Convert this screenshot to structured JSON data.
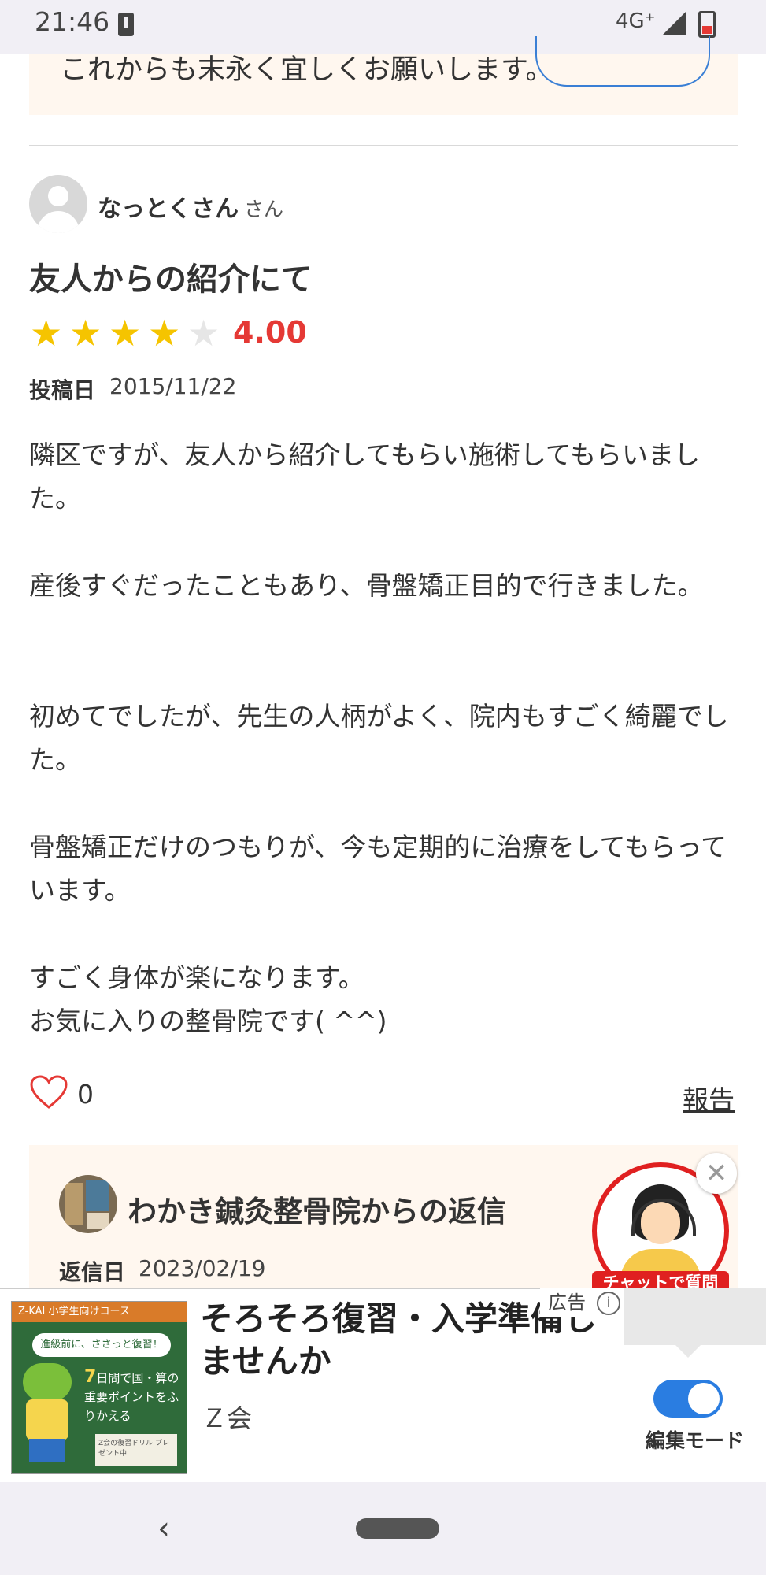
{
  "status_bar": {
    "time": "21:46",
    "network": "4G⁺"
  },
  "previous_reply": {
    "text_tail": "これからも末永く宜しくお願いします。",
    "button_label": ""
  },
  "review": {
    "reviewer_name": "なっとくさん",
    "reviewer_suffix": "さん",
    "title": "友人からの紹介にて",
    "stars": {
      "filled": 4,
      "total": 5
    },
    "rating": "4.00",
    "post_label": "投稿日",
    "post_date": "2015/11/22",
    "paragraphs": [
      "隣区ですが、友人から紹介してもらい施術してもらいました。",
      "産後すぐだったこともあり、骨盤矯正目的で行きました。",
      "初めてでしたが、先生の人柄がよく、院内もすごく綺麗でした。",
      "骨盤矯正だけのつもりが、今も定期的に治療をしてもらっています。",
      "すごく身体が楽になります。",
      "お気に入りの整骨院です( ^^)"
    ],
    "like_count": "0",
    "report_label": "報告"
  },
  "reply": {
    "title": "わかき鍼灸整骨院からの返信",
    "date_label": "返信日",
    "date": "2023/02/19"
  },
  "chat_widget": {
    "label": "チャットで質問",
    "close": "✕"
  },
  "ad": {
    "image_brand": "Z-KAI 小学生向けコース",
    "image_bubble": "進級前に、ささっと復習！",
    "image_text_1": "7",
    "image_text_2": "日間で国・算の重要ポイントをふりかえる",
    "image_book": "Z会の復習ドリル プレゼント中",
    "headline": "そろそろ復習・入学準備しませんか",
    "sponsor": "Ｚ会",
    "label": "広告",
    "info_icon": "i"
  },
  "edit_mode": {
    "label": "編集モード",
    "enabled": true
  },
  "nav": {
    "back": "‹"
  },
  "colors": {
    "star": "#f5c400",
    "star_empty": "#e6e6e6",
    "rating": "#e53935",
    "chat_red": "#e02020",
    "toggle_blue": "#2a7de1"
  },
  "icons": [
    "alert-icon",
    "signal-icon",
    "battery-icon",
    "avatar-icon",
    "star-icon",
    "heart-icon",
    "close-icon",
    "info-icon",
    "back-icon",
    "home-icon"
  ]
}
